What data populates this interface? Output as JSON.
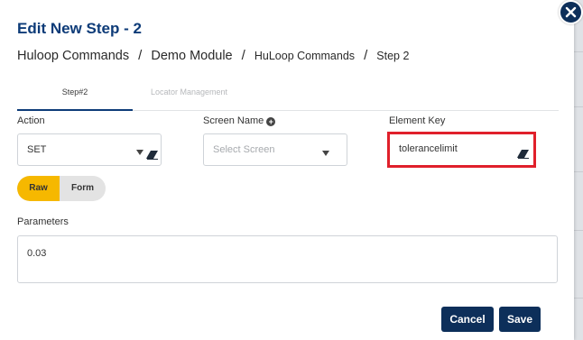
{
  "modal": {
    "title": "Edit New Step - 2",
    "breadcrumb": [
      "Huloop Commands",
      "Demo Module",
      "HuLoop Commands",
      "Step 2"
    ],
    "breadcrumb_sep": "/"
  },
  "tabs": [
    {
      "label": "Step#2",
      "active": true
    },
    {
      "label": "Locator Management",
      "active": false
    }
  ],
  "action": {
    "label": "Action",
    "value": "SET"
  },
  "screen_name": {
    "label": "Screen Name",
    "placeholder": "Select Screen"
  },
  "element_key": {
    "label": "Element Key",
    "value": "tolerancelimit"
  },
  "mode_toggle": {
    "options": [
      "Raw",
      "Form"
    ],
    "selected": "Raw"
  },
  "parameters": {
    "label": "Parameters",
    "value": "0.03"
  },
  "buttons": {
    "cancel": "Cancel",
    "save": "Save"
  },
  "colors": {
    "primary": "#0d2f5a",
    "title": "#0d3b78",
    "accent": "#f6b800",
    "highlight": "#e0202b"
  },
  "icons": [
    "close-icon",
    "plus-circle-icon",
    "chevron-down-icon",
    "eraser-icon"
  ]
}
